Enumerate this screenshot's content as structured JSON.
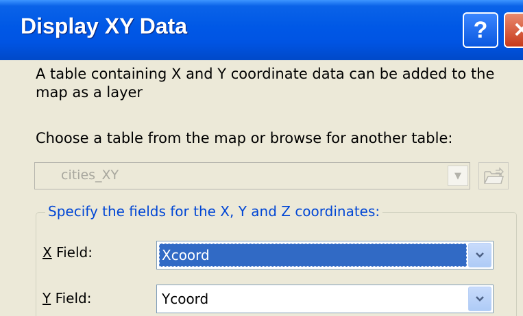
{
  "window": {
    "title": "Display XY Data",
    "help_label": "?",
    "close_label": "✕"
  },
  "description": "A table containing X and Y coordinate data can be added to the map as a layer",
  "choose_label": "Choose a table from the map or browse for another table:",
  "table_select": {
    "value": "cities_XY",
    "enabled": false
  },
  "coordinates_group": {
    "legend": "Specify the fields for the X, Y and Z coordinates:",
    "x_field": {
      "accel": "X",
      "label_rest": " Field:",
      "value": "Xcoord",
      "selected": true
    },
    "y_field": {
      "accel": "Y",
      "label_rest": " Field:",
      "value": "Ycoord",
      "selected": false
    }
  },
  "colors": {
    "titlebar": "#0054e3",
    "dialog_bg": "#ece9d8",
    "legend_text": "#0046d5",
    "selection": "#316ac5",
    "close_button": "#c7391b"
  }
}
